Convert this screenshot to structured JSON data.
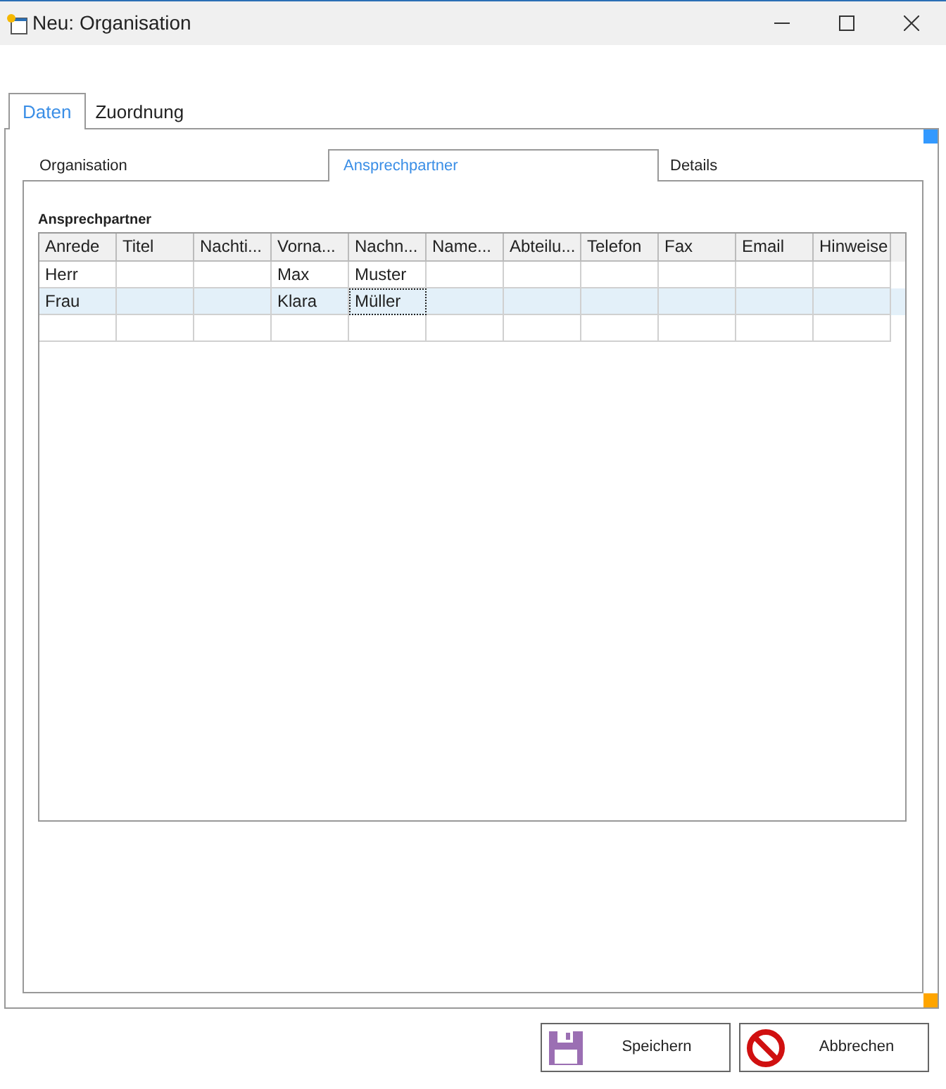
{
  "window": {
    "title": "Neu: Organisation"
  },
  "tabs": [
    {
      "label": "Daten",
      "selected": true
    },
    {
      "label": "Zuordnung",
      "selected": false
    }
  ],
  "sub_tabs": [
    {
      "label": "Organisation",
      "selected": false
    },
    {
      "label": "Ansprechpartner",
      "selected": true
    },
    {
      "label": "Details",
      "selected": false
    }
  ],
  "grid": {
    "title": "Ansprechpartner",
    "columns": [
      "Anrede",
      "Titel",
      "Nachti...",
      "Vorna...",
      "Nachn...",
      "Name...",
      "Abteilu...",
      "Telefon",
      "Fax",
      "Email",
      "Hinweise"
    ],
    "rows": [
      {
        "selected": false,
        "cells": [
          {
            "text": "Herr",
            "focused": false
          },
          {
            "focused": false
          },
          {
            "focused": false
          },
          {
            "text": "Max",
            "focused": false
          },
          {
            "text": "Muster",
            "focused": false
          },
          {
            "focused": false
          },
          {
            "focused": false
          },
          {
            "focused": false
          },
          {
            "focused": false
          },
          {
            "focused": false
          },
          {
            "focused": false
          }
        ]
      },
      {
        "selected": true,
        "cells": [
          {
            "text": "Frau",
            "focused": false
          },
          {
            "focused": false
          },
          {
            "focused": false
          },
          {
            "text": "Klara",
            "focused": false
          },
          {
            "text": "Müller",
            "focused": true
          },
          {
            "focused": false
          },
          {
            "focused": false
          },
          {
            "focused": false
          },
          {
            "focused": false
          },
          {
            "focused": false
          },
          {
            "focused": false
          }
        ]
      }
    ]
  },
  "buttons": [
    {
      "kind": "save",
      "label": "Speichern"
    },
    {
      "kind": "cancel",
      "label": "Abbrechen"
    }
  ]
}
